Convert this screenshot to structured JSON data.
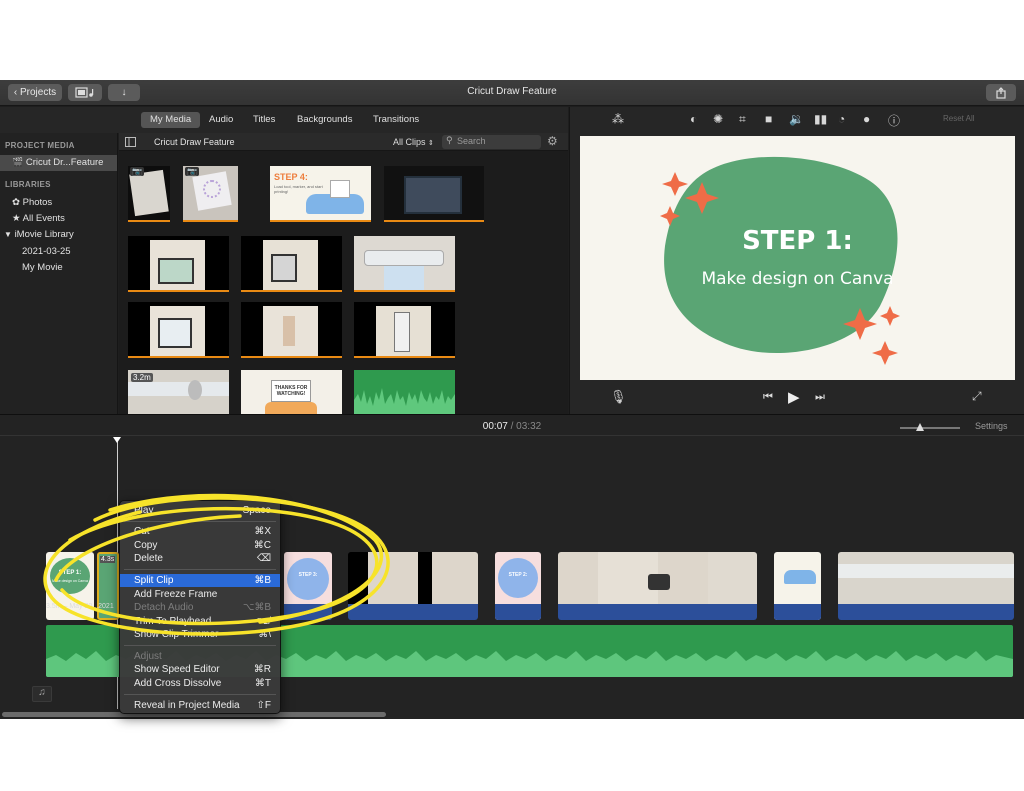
{
  "titlebar": {
    "projects_label": "Projects",
    "window_title": "Cricut Draw Feature"
  },
  "tabs": [
    {
      "label": "My Media",
      "active": true
    },
    {
      "label": "Audio",
      "active": false
    },
    {
      "label": "Titles",
      "active": false
    },
    {
      "label": "Backgrounds",
      "active": false
    },
    {
      "label": "Transitions",
      "active": false
    }
  ],
  "sidebar": {
    "project_media_heading": "PROJECT MEDIA",
    "project_item": "Cricut Dr...Feature",
    "libraries_heading": "LIBRARIES",
    "photos": "Photos",
    "all_events": "All Events",
    "library": "iMovie Library",
    "event_date": "2021-03-25",
    "my_movie": "My Movie"
  },
  "browser": {
    "title": "Cricut Draw Feature",
    "filter": "All Clips",
    "search_placeholder": "Search",
    "step4_title": "STEP 4:",
    "step4_sub": "Load tool, marker, and start printing!",
    "thanks_text": "THANKS FOR WATCHING!",
    "duration_badge": "3.2m"
  },
  "viewer": {
    "reset_all": "Reset All",
    "slide_title": "STEP 1:",
    "slide_subtitle": "Make design on Canva"
  },
  "timeline": {
    "current_time": "00:07",
    "separator": "/",
    "total_time": "03:32",
    "settings": "Settings",
    "clip_badge": "4.3s",
    "clip_info": "3.5m – May 20...2021",
    "clip_step1": "STEP 1:",
    "clip_step1_sub": "Make design on Canva",
    "clip_step2": "STEP 2:",
    "clip_step3": "STEP 3:"
  },
  "context_menu": {
    "play": {
      "label": "Play",
      "shortcut": "Space"
    },
    "cut": {
      "label": "Cut",
      "shortcut": "⌘X"
    },
    "copy": {
      "label": "Copy",
      "shortcut": "⌘C"
    },
    "delete": {
      "label": "Delete",
      "shortcut": "⌫"
    },
    "split_clip": {
      "label": "Split Clip",
      "shortcut": "⌘B"
    },
    "add_freeze_frame": {
      "label": "Add Freeze Frame",
      "shortcut": ""
    },
    "detach_audio": {
      "label": "Detach Audio",
      "shortcut": "⌥⌘B"
    },
    "trim_to_playhead": {
      "label": "Trim To Playhead",
      "shortcut": "⌥/"
    },
    "show_clip_trimmer": {
      "label": "Show Clip Trimmer",
      "shortcut": "⌘\\"
    },
    "adjust": {
      "label": "Adjust",
      "shortcut": ""
    },
    "show_speed_editor": {
      "label": "Show Speed Editor",
      "shortcut": "⌘R"
    },
    "add_cross_dissolve": {
      "label": "Add Cross Dissolve",
      "shortcut": "⌘T"
    },
    "reveal_in_project_media": {
      "label": "Reveal in Project Media",
      "shortcut": "⇧F"
    }
  },
  "colors": {
    "accent_green": "#5aa574",
    "marker_orange": "#e98a14",
    "highlight_blue": "#2a6ad8",
    "scribble_yellow": "#f7e32a",
    "sparkle_orange": "#ef6c47"
  }
}
